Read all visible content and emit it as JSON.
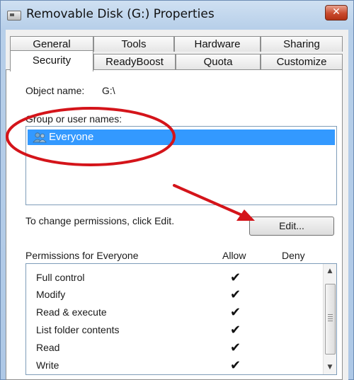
{
  "window": {
    "title": "Removable Disk (G:) Properties",
    "close_glyph": "✕"
  },
  "tabs_row1": [
    {
      "label": "General"
    },
    {
      "label": "Tools"
    },
    {
      "label": "Hardware"
    },
    {
      "label": "Sharing"
    }
  ],
  "tabs_row2": [
    {
      "label": "Security",
      "active": true
    },
    {
      "label": "ReadyBoost"
    },
    {
      "label": "Quota"
    },
    {
      "label": "Customize"
    }
  ],
  "security": {
    "object_name_label": "Object name:",
    "object_name_value": "G:\\",
    "group_label": "Group or user names:",
    "users": [
      {
        "name": "Everyone",
        "selected": true,
        "icon": "users-icon"
      }
    ],
    "change_hint": "To change permissions, click Edit.",
    "edit_button": "Edit...",
    "permissions_label": "Permissions for Everyone",
    "allow_header": "Allow",
    "deny_header": "Deny",
    "permissions": [
      {
        "name": "Full control",
        "allow": true,
        "deny": false
      },
      {
        "name": "Modify",
        "allow": true,
        "deny": false
      },
      {
        "name": "Read & execute",
        "allow": true,
        "deny": false
      },
      {
        "name": "List folder contents",
        "allow": true,
        "deny": false
      },
      {
        "name": "Read",
        "allow": true,
        "deny": false
      },
      {
        "name": "Write",
        "allow": true,
        "deny": false
      }
    ],
    "check_glyph": "✔"
  },
  "colors": {
    "selection": "#3399ff",
    "annotation_red": "#d4141a"
  }
}
